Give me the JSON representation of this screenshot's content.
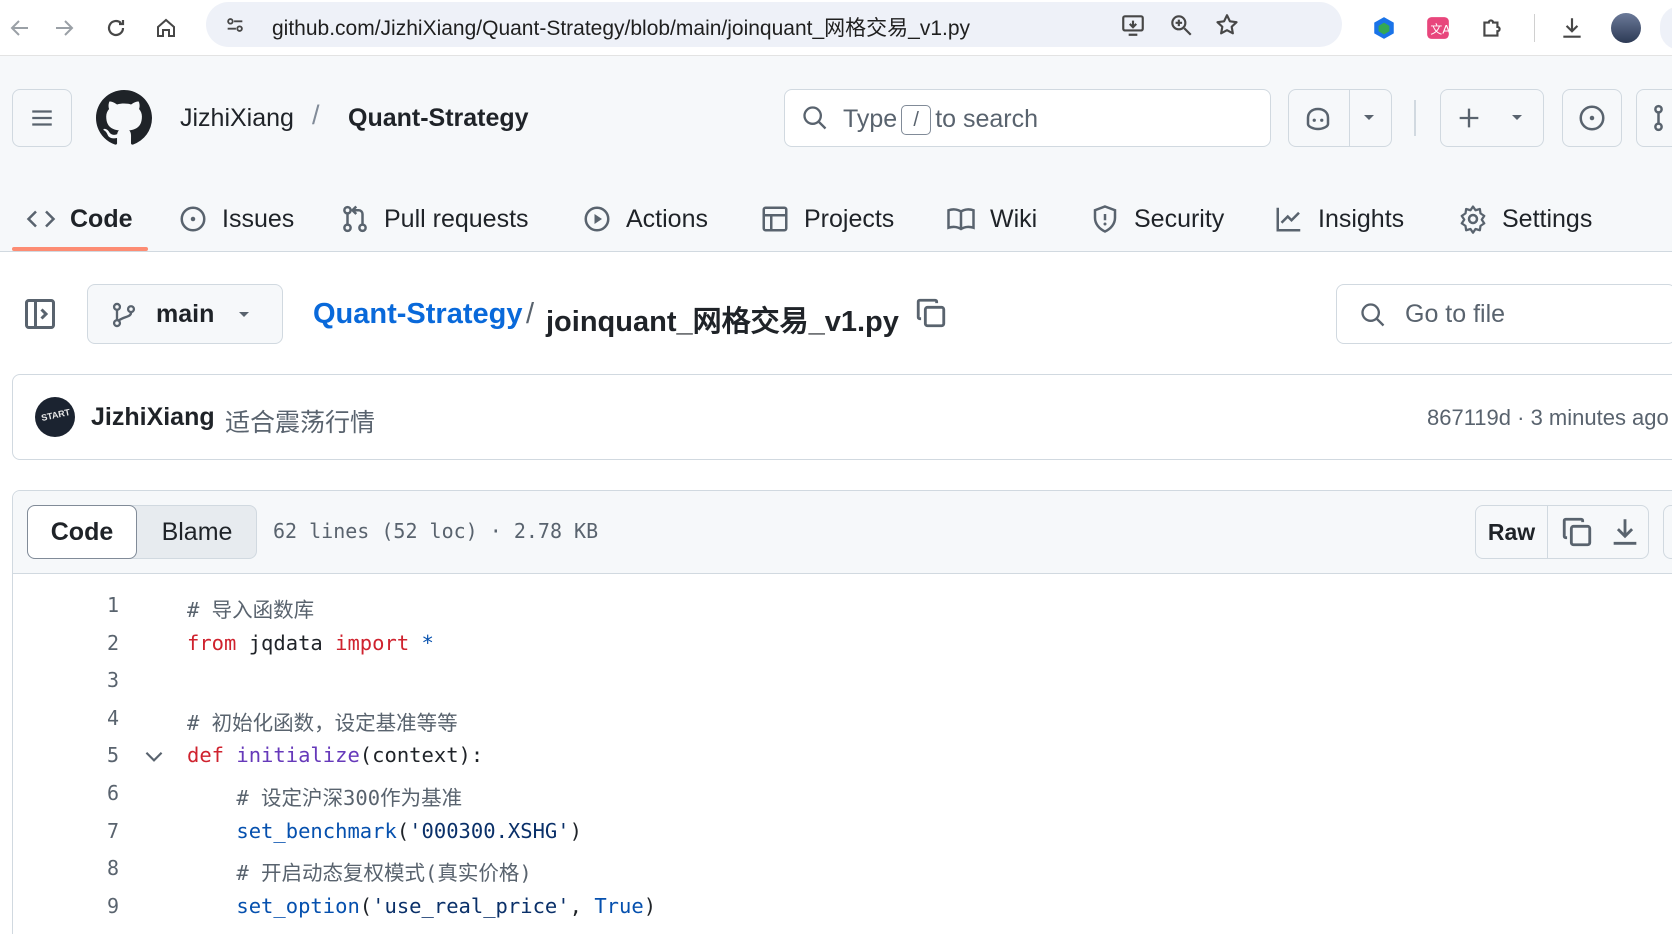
{
  "browser": {
    "url": "github.com/JizhiXiang/Quant-Strategy/blob/main/joinquant_网格交易_v1.py"
  },
  "header": {
    "owner": "JizhiXiang",
    "separator": "/",
    "repo": "Quant-Strategy",
    "search_prefix": "Type",
    "search_key": "/",
    "search_suffix": "to search"
  },
  "tabs": [
    {
      "label": "Code",
      "icon": "code-icon",
      "active": true
    },
    {
      "label": "Issues",
      "icon": "issue-icon"
    },
    {
      "label": "Pull requests",
      "icon": "pull-request-icon"
    },
    {
      "label": "Actions",
      "icon": "play-icon"
    },
    {
      "label": "Projects",
      "icon": "table-icon"
    },
    {
      "label": "Wiki",
      "icon": "book-icon"
    },
    {
      "label": "Security",
      "icon": "shield-icon"
    },
    {
      "label": "Insights",
      "icon": "graph-icon"
    },
    {
      "label": "Settings",
      "icon": "gear-icon"
    }
  ],
  "file_nav": {
    "branch": "main",
    "path_repo": "Quant-Strategy",
    "path_sep": "/",
    "file_name": "joinquant_网格交易_v1.py",
    "go_to_file_placeholder": "Go to file"
  },
  "commit": {
    "author": "JizhiXiang",
    "message": "适合震荡行情",
    "avatar_text": "START",
    "meta": "867119d · 3 minutes ago"
  },
  "file_view": {
    "code_tab": "Code",
    "blame_tab": "Blame",
    "info": "62 lines (52 loc) · 2.78 KB",
    "raw_label": "Raw"
  },
  "code": [
    {
      "n": "1",
      "tokens": [
        {
          "t": "# 导入函数库",
          "c": "comment"
        }
      ]
    },
    {
      "n": "2",
      "tokens": [
        {
          "t": "from",
          "c": "kw"
        },
        {
          "t": " jqdata ",
          "c": ""
        },
        {
          "t": "import",
          "c": "kw"
        },
        {
          "t": " *",
          "c": "const"
        }
      ]
    },
    {
      "n": "3",
      "tokens": []
    },
    {
      "n": "4",
      "tokens": [
        {
          "t": "# 初始化函数，设定基准等等",
          "c": "comment"
        }
      ]
    },
    {
      "n": "5",
      "fold": true,
      "tokens": [
        {
          "t": "def",
          "c": "kw"
        },
        {
          "t": " ",
          "c": ""
        },
        {
          "t": "initialize",
          "c": "fn"
        },
        {
          "t": "(context):",
          "c": ""
        }
      ]
    },
    {
      "n": "6",
      "tokens": [
        {
          "t": "    # 设定沪深300作为基准",
          "c": "comment"
        }
      ]
    },
    {
      "n": "7",
      "tokens": [
        {
          "t": "    ",
          "c": ""
        },
        {
          "t": "set_benchmark",
          "c": "call"
        },
        {
          "t": "(",
          "c": ""
        },
        {
          "t": "'000300.XSHG'",
          "c": "str"
        },
        {
          "t": ")",
          "c": ""
        }
      ]
    },
    {
      "n": "8",
      "tokens": [
        {
          "t": "    # 开启动态复权模式(真实价格)",
          "c": "comment"
        }
      ]
    },
    {
      "n": "9",
      "tokens": [
        {
          "t": "    ",
          "c": ""
        },
        {
          "t": "set_option",
          "c": "call"
        },
        {
          "t": "(",
          "c": ""
        },
        {
          "t": "'use_real_price'",
          "c": "str"
        },
        {
          "t": ", ",
          "c": ""
        },
        {
          "t": "True",
          "c": "const"
        },
        {
          "t": ")",
          "c": ""
        }
      ]
    }
  ]
}
